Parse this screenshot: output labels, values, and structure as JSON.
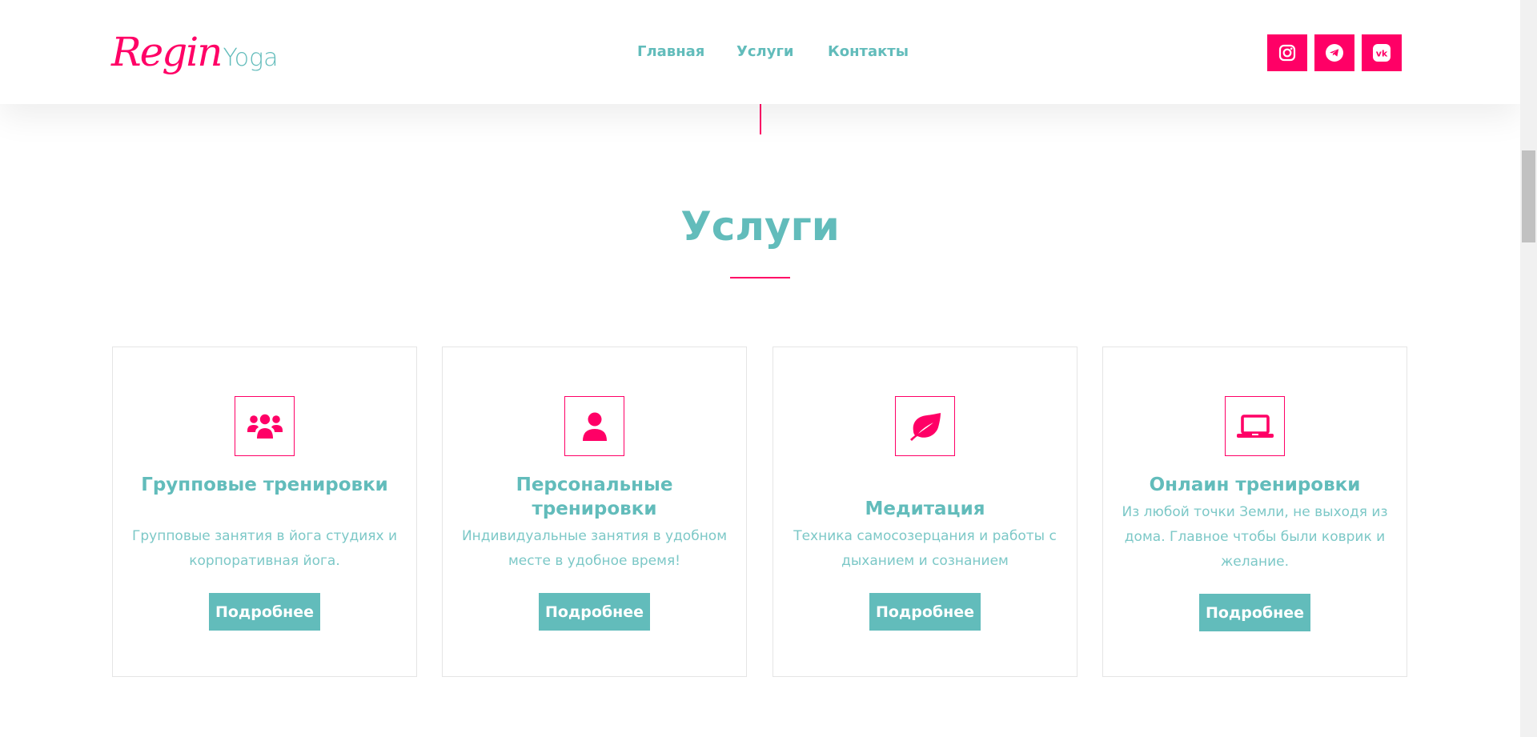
{
  "brand": {
    "script": "Regin",
    "word": "Yoga",
    "accent_color": "#ff0066",
    "teal_color": "#62bcbb"
  },
  "nav": {
    "items": [
      "Главная",
      "Услуги",
      "Контакты"
    ]
  },
  "social": {
    "icons": [
      "instagram-icon",
      "telegram-icon",
      "vk-icon"
    ],
    "vk_text": "vk"
  },
  "section": {
    "title": "Услуги"
  },
  "services": [
    {
      "icon": "group-icon",
      "title": "Групповые тренировки",
      "description": "Групповые занятия в йога студиях и корпоративная йога.",
      "button": "Подробнее"
    },
    {
      "icon": "person-icon",
      "title": "Персональные тренировки",
      "description": "Индивидуальные занятия в удобном месте в удобное время!",
      "button": "Подробнее"
    },
    {
      "icon": "leaf-icon",
      "title": "Медитация",
      "description": "Техника самосозерцания и работы с дыханием и сознанием",
      "button": "Подробнее"
    },
    {
      "icon": "laptop-icon",
      "title": "Онлаин тренировки",
      "description": "Из любой точки Земли, не выходя из дома. Главное чтобы были коврик и желание.",
      "button": "Подробнее"
    }
  ]
}
